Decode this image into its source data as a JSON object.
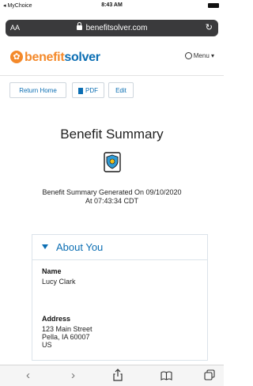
{
  "status": {
    "carrier": "◂ MyChoice",
    "time": "8:43 AM"
  },
  "browser": {
    "aa": "AA",
    "url": "benefitsolver.com",
    "reload": "↻"
  },
  "header": {
    "logo_part1": "benefit",
    "logo_part2": "solver",
    "menu": "Menu ▾"
  },
  "toolbar": {
    "return_home": "Return Home",
    "pdf": "PDF",
    "edit": "Edit"
  },
  "page": {
    "title": "Benefit Summary",
    "generated_line1": "Benefit Summary Generated On 09/10/2020",
    "generated_line2": "At 07:43:34 CDT"
  },
  "about": {
    "heading": "About You",
    "name_label": "Name",
    "name_value": "Lucy Clark",
    "address_label": "Address",
    "address_line1": "123 Main Street",
    "address_line2": "Pella, IA 60007",
    "address_line3": "US"
  },
  "safari_toolbar": {
    "back": "‹",
    "forward": "›"
  },
  "colors": {
    "brand_orange": "#f4892a",
    "brand_blue": "#0b6eb3",
    "url_bar": "#3a3a3c"
  }
}
